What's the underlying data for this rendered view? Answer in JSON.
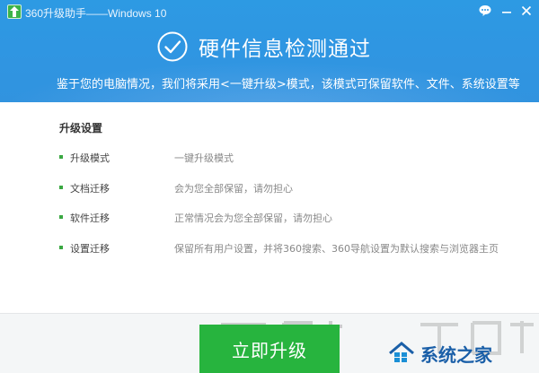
{
  "window": {
    "title": "360升级助手——Windows 10",
    "feedback_icon": "chat-bubble-icon",
    "minimize_icon": "minimize-icon",
    "close_icon": "close-icon"
  },
  "header": {
    "headline": "硬件信息检测通过",
    "subline": "鉴于您的电脑情况，我们将采用<一键升级>模式，该模式可保留软件、文件、系统设置等",
    "check_icon": "check-circle-icon"
  },
  "settings": {
    "title": "升级设置",
    "rows": [
      {
        "label": "升级模式",
        "desc": "一键升级模式"
      },
      {
        "label": "文档迁移",
        "desc": "会为您全部保留，请勿担心"
      },
      {
        "label": "软件迁移",
        "desc": "正常情况会为您全部保留，请勿担心"
      },
      {
        "label": "设置迁移",
        "desc": "保留所有用户设置，并将360搜索、360导航设置为默认搜索与浏览器主页"
      }
    ]
  },
  "footer": {
    "upgrade_button": "立即升级",
    "logo_text": "系统之家"
  },
  "colors": {
    "header_blue": "#2f96e2",
    "button_green": "#27b43e",
    "bullet_green": "#3aa842"
  }
}
